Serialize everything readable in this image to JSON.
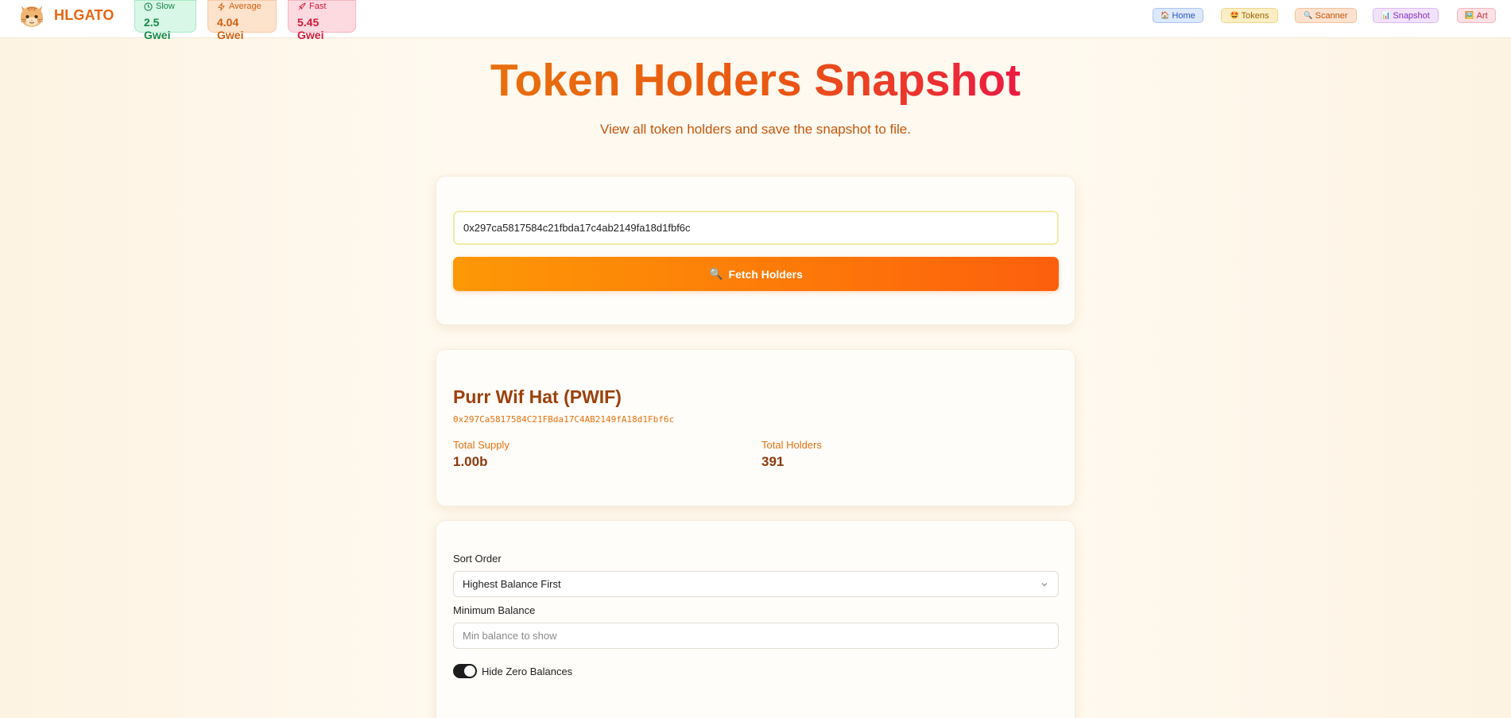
{
  "brand": {
    "name": "HLGATO",
    "logo_icon": "cat-face-icon"
  },
  "gas": {
    "slow": {
      "label": "Slow",
      "value": "2.5 Gwei",
      "icon": "clock-icon"
    },
    "average": {
      "label": "Average",
      "value": "4.04 Gwei",
      "icon": "lightning-icon"
    },
    "fast": {
      "label": "Fast",
      "value": "5.45 Gwei",
      "icon": "rocket-icon"
    }
  },
  "nav": {
    "home": {
      "emoji": "🏠",
      "label": "Home"
    },
    "tokens": {
      "emoji": "🤩",
      "label": "Tokens"
    },
    "scanner": {
      "emoji": "🔍",
      "label": "Scanner"
    },
    "snapshot": {
      "emoji": "📊",
      "label": "Snapshot"
    },
    "art": {
      "emoji": "🖼️",
      "label": "Art"
    }
  },
  "hero": {
    "title": "Token Holders Snapshot",
    "subtitle": "View all token holders and save the snapshot to file."
  },
  "search": {
    "address_value": "0x297ca5817584c21fbda17c4ab2149fa18d1fbf6c",
    "button_emoji": "🔍",
    "button_label": "Fetch Holders"
  },
  "token": {
    "name": "Purr Wif Hat (PWIF)",
    "address": "0x297Ca5817584C21FBda17C4AB2149fA18d1Fbf6c",
    "total_supply_label": "Total Supply",
    "total_supply_value": "1.00b",
    "total_holders_label": "Total Holders",
    "total_holders_value": "391"
  },
  "filters": {
    "sort_label": "Sort Order",
    "sort_value": "Highest Balance First",
    "min_label": "Minimum Balance",
    "min_placeholder": "Min balance to show",
    "hide_zero_label": "Hide Zero Balances",
    "hide_zero_on": true
  },
  "colors": {
    "accent": "#e8650f",
    "title_gradient_start": "#e8700c",
    "title_gradient_end": "#ec1a43",
    "button_gradient_start": "#fd9806",
    "button_gradient_end": "#fd5f0d"
  }
}
